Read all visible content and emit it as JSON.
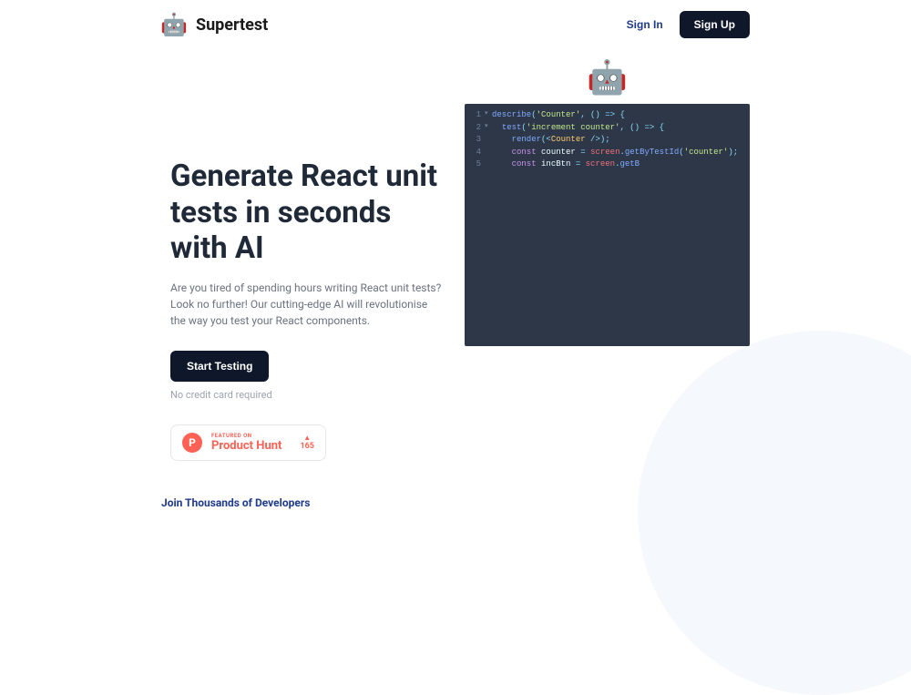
{
  "header": {
    "brand": "Supertest",
    "signin_label": "Sign In",
    "signup_label": "Sign Up"
  },
  "hero": {
    "title": "Generate React unit tests in seconds with AI",
    "subtitle": "Are you tired of spending hours writing React unit tests? Look no further! Our cutting-edge AI will revolutionise the way you test your React components.",
    "cta_label": "Start Testing",
    "no_cc": "No credit card required"
  },
  "product_hunt": {
    "featured": "FEATURED ON",
    "name": "Product Hunt",
    "votes": "165"
  },
  "code": {
    "lines": [
      {
        "num": "1",
        "fold": "▾"
      },
      {
        "num": "2",
        "fold": "▾"
      },
      {
        "num": "3",
        "fold": ""
      },
      {
        "num": "4",
        "fold": ""
      },
      {
        "num": "5",
        "fold": ""
      }
    ]
  },
  "footer": {
    "section_label": "Join Thousands of Developers"
  }
}
